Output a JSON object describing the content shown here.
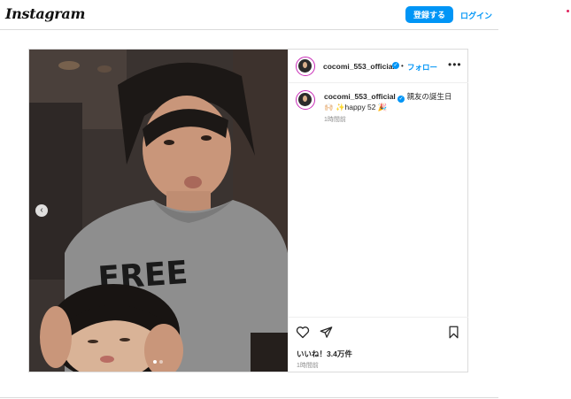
{
  "header": {
    "logo": "Instagram",
    "login_label": "登録する",
    "signup_label": "ログイン"
  },
  "post": {
    "username": "cocomi_553_official",
    "follow_label": "フォロー",
    "separator": "•",
    "more_label": "•••",
    "caption_text": "親友の誕生日",
    "caption_line2": "✨happy 52 🎉",
    "caption_time": "1時間前",
    "likes": "いいね！3.4万件",
    "post_time": "1時間前",
    "carousel": {
      "total": 2,
      "active": 1
    },
    "prev_arrow": "‹",
    "icons": {
      "prev": "chevron-left-icon",
      "like": "heart-icon",
      "share": "send-icon",
      "save": "bookmark-icon",
      "verified": "verified-badge-icon"
    }
  },
  "colors": {
    "accent": "#0095f6",
    "border": "#dbdbdb",
    "text": "#262626",
    "muted": "#8e8e8e",
    "avatar_ring": "#c92bb7"
  }
}
